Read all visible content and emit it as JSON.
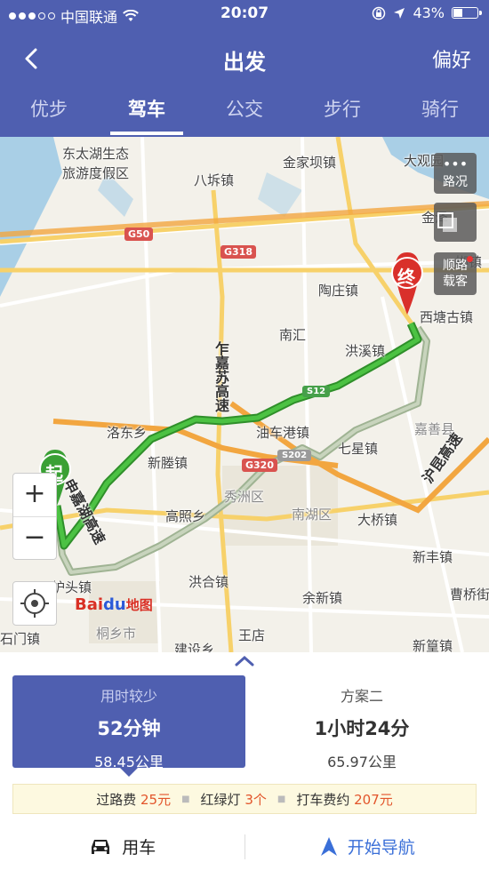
{
  "status": {
    "carrier": "中国联通",
    "time": "20:07",
    "battery": "43%",
    "battery_level": 0.43
  },
  "nav": {
    "title": "出发",
    "pref": "偏好"
  },
  "tabs": [
    "优步",
    "驾车",
    "公交",
    "步行",
    "骑行"
  ],
  "active_tab": 1,
  "map": {
    "labels": {
      "dongtaihu": "东太湖生态",
      "dongtaihu2": "旅游度假区",
      "bachi": "八坼镇",
      "jinjiaba": "金家坝镇",
      "daguanyuan": "大观园",
      "jinze": "金泽",
      "taoyuan": "陶庄镇",
      "nanhui": "南汇",
      "hongxi": "洪溪镇",
      "xitang": "西塘古镇",
      "luodong": "洛东乡",
      "youche": "油车港镇",
      "xiaxing": "七星镇",
      "jiashan": "嘉善县",
      "xinteng": "新塍镇",
      "gaozhao": "高照乡",
      "xiuzhou": "秀洲区",
      "nanhu": "南湖区",
      "daqiao": "大桥镇",
      "xinfeng": "新丰镇",
      "tutou": "炉头镇",
      "honghe": "洪合镇",
      "yuxin": "余新镇",
      "caoqiao": "曹桥街",
      "tongxiang": "桐乡市",
      "wangdian": "王店",
      "jianshe": "建设乡",
      "xinhuang": "新篁镇",
      "shimen": "石门镇",
      "sha": "梆镇"
    },
    "shields": {
      "g50": "G50",
      "g318": "G318",
      "g320": "G320",
      "s12": "S12",
      "s202": "S202"
    },
    "highways": {
      "shenjiasu": "申嘉湖高速",
      "jiasu": "乍嘉苏高速",
      "hukun": "沪昆高速"
    },
    "buttons": {
      "traffic": "路况",
      "carpool": "顺路载客"
    },
    "start_marker": "起",
    "end_marker": "终",
    "logo": {
      "bai": "Bai",
      "du": "du",
      "ditu": "地图"
    },
    "zoom_in": "+",
    "zoom_out": "−"
  },
  "plans": [
    {
      "name": "用时较少",
      "time": "52分钟",
      "distance": "58.45公里"
    },
    {
      "name": "方案二",
      "time": "1小时24分",
      "distance": "65.97公里"
    }
  ],
  "info": {
    "toll_label": "过路费",
    "toll_value": "25元",
    "lights_label": "红绿灯",
    "lights_value": "3个",
    "taxi_label": "打车费约",
    "taxi_value": "207元"
  },
  "bottom": {
    "car": "用车",
    "navigate": "开始导航"
  },
  "colors": {
    "brand": "#4f5fb0",
    "route_primary": "#3aa035",
    "route_alt": "#a8b89c",
    "accent_value": "#e2552b"
  }
}
